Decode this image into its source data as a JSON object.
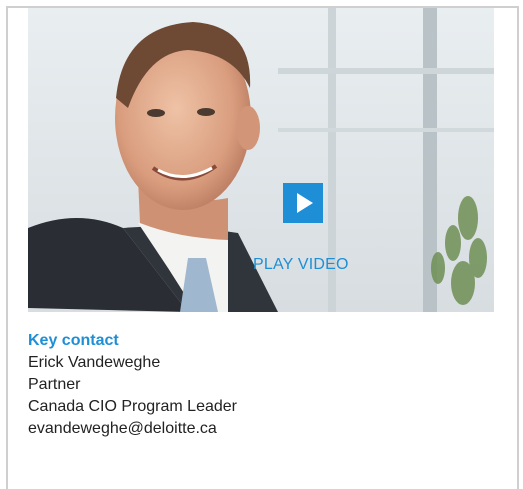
{
  "video": {
    "play_label": "PLAY VIDEO",
    "accent_color": "#1e8fd6",
    "play_icon": "play-icon"
  },
  "contact": {
    "heading": "Key contact",
    "name": "Erick Vandeweghe",
    "title": "Partner",
    "role": "Canada CIO Program Leader",
    "email": "evandeweghe@deloitte.ca"
  }
}
